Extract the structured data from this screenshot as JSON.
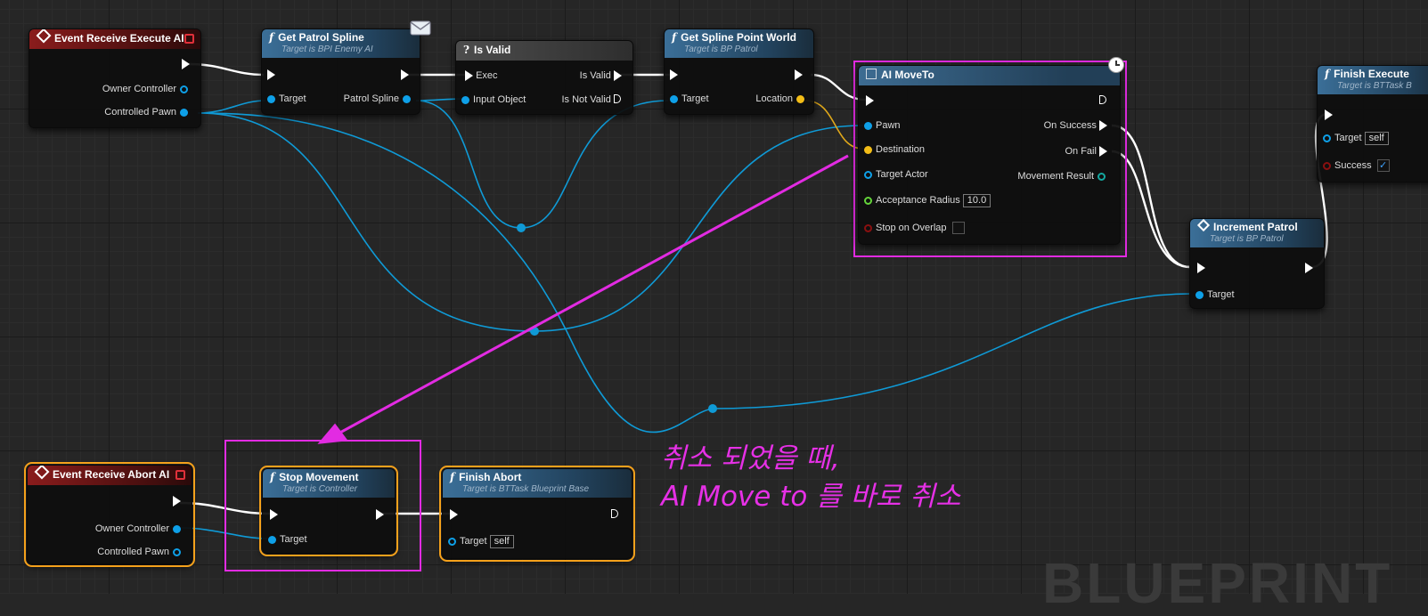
{
  "watermark": "BLUEPRINT",
  "annotation": {
    "line1": "취소 되었을 때,",
    "line2": "AI Move to 를 바로 취소"
  },
  "nodes": {
    "event_execute": {
      "title": "Event Receive Execute AI",
      "owner": "Owner Controller",
      "pawn": "Controlled Pawn"
    },
    "get_patrol_spline": {
      "title": "Get Patrol Spline",
      "subtitle": "Target is BPI Enemy AI",
      "target": "Target",
      "out": "Patrol Spline"
    },
    "is_valid": {
      "title": "Is Valid",
      "exec": "Exec",
      "input": "Input Object",
      "valid": "Is Valid",
      "not_valid": "Is Not Valid"
    },
    "get_spline_point": {
      "title": "Get Spline Point World",
      "subtitle": "Target is BP Patrol",
      "target": "Target",
      "location": "Location"
    },
    "ai_move_to": {
      "title": "AI MoveTo",
      "pawn": "Pawn",
      "destination": "Destination",
      "target_actor": "Target Actor",
      "acceptance": "Acceptance Radius",
      "acceptance_value": "10.0",
      "stop_overlap": "Stop on Overlap",
      "on_success": "On Success",
      "on_fail": "On Fail",
      "movement_result": "Movement Result"
    },
    "finish_execute": {
      "title": "Finish Execute",
      "subtitle": "Target is BTTask B",
      "target": "Target",
      "target_value": "self",
      "success": "Success"
    },
    "increment_patrol": {
      "title": "Increment Patrol",
      "subtitle": "Target is BP Patrol",
      "target": "Target"
    },
    "event_abort": {
      "title": "Event Receive Abort AI",
      "owner": "Owner Controller",
      "pawn": "Controlled Pawn"
    },
    "stop_movement": {
      "title": "Stop Movement",
      "subtitle": "Target is Controller",
      "target": "Target"
    },
    "finish_abort": {
      "title": "Finish Abort",
      "subtitle": "Target is BTTask Blueprint Base",
      "target": "Target",
      "target_value": "self"
    }
  },
  "colors": {
    "exec_wire": "#ffffff",
    "object_wire": "#0f9ad6",
    "vector_wire": "#e0a81a",
    "annotation": "#e22be2",
    "selection": "#f5a11b"
  }
}
